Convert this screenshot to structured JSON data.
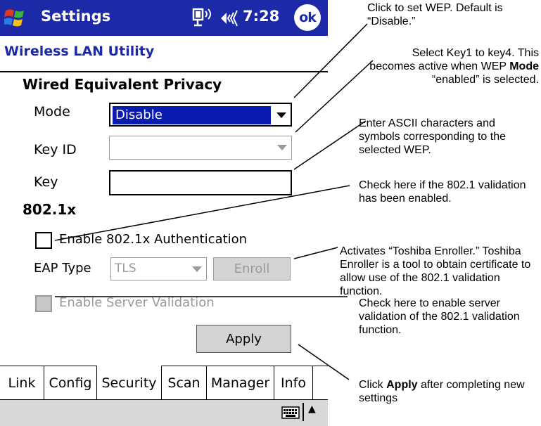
{
  "titlebar": {
    "title": "Settings",
    "time": "7:28",
    "ok_label": "ok"
  },
  "app": {
    "title": "Wireless LAN Utility"
  },
  "wep": {
    "heading": "Wired Equivalent Privacy",
    "mode_label": "Mode",
    "mode_value": "Disable",
    "keyid_label": "Key ID",
    "keyid_value": "",
    "key_label": "Key",
    "key_value": ""
  },
  "dot1x": {
    "heading": "802.1x",
    "enable_auth_label": "Enable 802.1x Authentication",
    "eap_label": "EAP Type",
    "eap_value": "TLS",
    "enroll_label": "Enroll",
    "server_validation_label": "Enable Server Validation"
  },
  "apply_label": "Apply",
  "tabs": [
    "Link",
    "Config",
    "Security",
    "Scan",
    "Manager",
    "Info"
  ],
  "active_tab": "Security",
  "annotations": {
    "wep_mode": "Click to set WEP. Default is “Disable.”",
    "key_id_1": "Select Key1 to key4. This becomes active when WEP",
    "key_id_bold": "Mode",
    "key_id_2": " “enabled” is selected.",
    "key": "Enter ASCII characters and symbols corresponding to the selected WEP.",
    "auth": "Check here if the 802.1 validation has been enabled.",
    "enroll": "Activates “Toshiba Enroller.” Toshiba Enroller is a tool to obtain certificate to allow use of the 802.1 validation function.",
    "server": "Check here to enable server validation of the 802.1 validation function.",
    "apply_1": "Click ",
    "apply_bold": "Apply",
    "apply_2": " after completing new settings"
  },
  "colors": {
    "titlebar": "#1d2aa8",
    "selection": "#0a1bb0",
    "disabled": "#9a9a9a",
    "bottombar": "#d8d8d8"
  },
  "icons": [
    "windows-start-icon",
    "connectivity-icon",
    "volume-icon",
    "keyboard-icon"
  ]
}
